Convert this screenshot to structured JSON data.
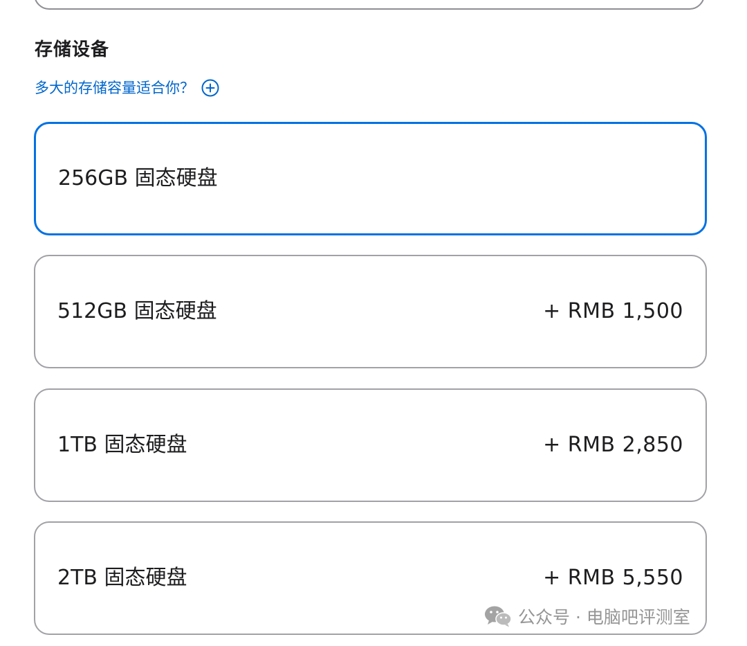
{
  "section": {
    "title": "存储设备",
    "help_link": "多大的存储容量适合你？",
    "help_icon": "plus-circle-icon"
  },
  "options": [
    {
      "label": "256GB 固态硬盘",
      "price": "",
      "selected": true
    },
    {
      "label": "512GB 固态硬盘",
      "price": "+ RMB 1,500",
      "selected": false
    },
    {
      "label": "1TB 固态硬盘",
      "price": "+ RMB 2,850",
      "selected": false
    },
    {
      "label": "2TB 固态硬盘",
      "price": "+ RMB 5,550",
      "selected": false
    }
  ],
  "watermark": {
    "text": "公众号 · 电脑吧评测室",
    "icon": "wechat-icon"
  },
  "colors": {
    "accent": "#0071e3",
    "link": "#0066cc",
    "border": "#a1a1a6",
    "text": "#1d1d1f"
  }
}
